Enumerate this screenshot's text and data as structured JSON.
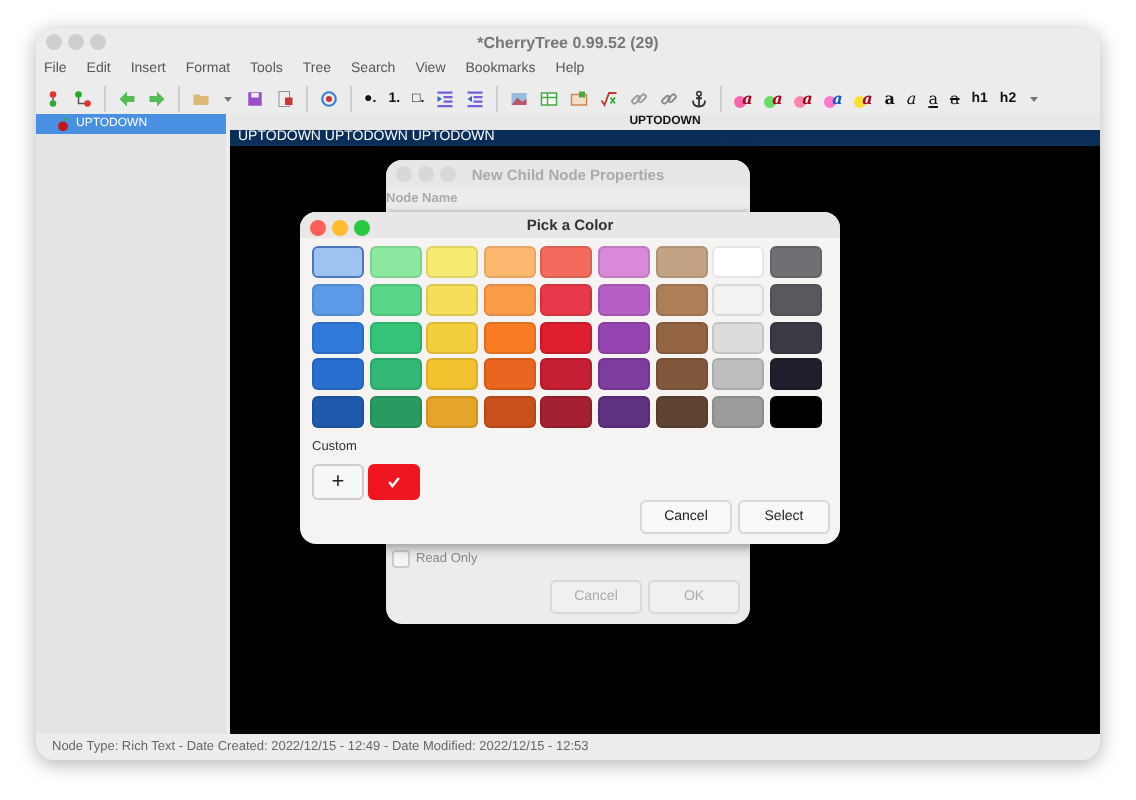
{
  "window": {
    "title": "*CherryTree 0.99.52 (29)"
  },
  "menu": [
    "File",
    "Edit",
    "Insert",
    "Format",
    "Tools",
    "Tree",
    "Search",
    "View",
    "Bookmarks",
    "Help"
  ],
  "toolbar": {
    "labels": [
      "●.",
      "1.",
      "□.",
      "a",
      "a",
      "a",
      "a",
      "a",
      "a",
      "a",
      "a",
      "a",
      "h1",
      "h2"
    ]
  },
  "tree": {
    "items": [
      {
        "label": "UPTODOWN",
        "selected": true
      }
    ]
  },
  "editor": {
    "node_title": "UPTODOWN",
    "text": "UPTODOWN UPTODOWN UPTODOWN"
  },
  "node_dialog": {
    "title": "New Child Node Properties",
    "field_label": "Node Name",
    "read_only": {
      "label": "Read Only",
      "checked": false
    },
    "buttons": [
      "Cancel",
      "OK"
    ]
  },
  "color_dialog": {
    "title": "Pick a Color",
    "colors": [
      {
        "color": "#9ec3f0",
        "selected": true
      },
      {
        "color": "#8de8a0",
        "selected": false
      },
      {
        "color": "#f7ea72",
        "selected": false
      },
      {
        "color": "#fdb870",
        "selected": false
      },
      {
        "color": "#f26b5c",
        "selected": false
      },
      {
        "color": "#d88ad8",
        "selected": false
      },
      {
        "color": "#c4a384",
        "selected": false
      },
      {
        "color": "#ffffff",
        "selected": false
      },
      {
        "color": "#707074",
        "selected": false
      },
      {
        "color": "#5b9ae6",
        "selected": false
      },
      {
        "color": "#5ad688",
        "selected": false
      },
      {
        "color": "#f6dd5a",
        "selected": false
      },
      {
        "color": "#fb9c48",
        "selected": false
      },
      {
        "color": "#e8394a",
        "selected": false
      },
      {
        "color": "#b65fc4",
        "selected": false
      },
      {
        "color": "#ad7f59",
        "selected": false
      },
      {
        "color": "#f2f2f2",
        "selected": false
      },
      {
        "color": "#58585e",
        "selected": false
      },
      {
        "color": "#2f7ad9",
        "selected": false
      },
      {
        "color": "#34c477",
        "selected": false
      },
      {
        "color": "#f4cf3d",
        "selected": false
      },
      {
        "color": "#f97c25",
        "selected": false
      },
      {
        "color": "#dc1e2f",
        "selected": false
      },
      {
        "color": "#9545b0",
        "selected": false
      },
      {
        "color": "#936443",
        "selected": false
      },
      {
        "color": "#dcdcdc",
        "selected": false
      },
      {
        "color": "#3a3a44",
        "selected": false
      },
      {
        "color": "#2a6fcf",
        "selected": false
      },
      {
        "color": "#33b775",
        "selected": false
      },
      {
        "color": "#f2c22e",
        "selected": false
      },
      {
        "color": "#e8661f",
        "selected": false
      },
      {
        "color": "#c51f34",
        "selected": false
      },
      {
        "color": "#7e3c9e",
        "selected": false
      },
      {
        "color": "#82583d",
        "selected": false
      },
      {
        "color": "#bebebe",
        "selected": false
      },
      {
        "color": "#201e2c",
        "selected": false
      },
      {
        "color": "#1f5aad",
        "selected": false
      },
      {
        "color": "#2a9b60",
        "selected": false
      },
      {
        "color": "#e5a42a",
        "selected": false
      },
      {
        "color": "#c8501a",
        "selected": false
      },
      {
        "color": "#a31f32",
        "selected": false
      },
      {
        "color": "#5f3181",
        "selected": false
      },
      {
        "color": "#5e4330",
        "selected": false
      },
      {
        "color": "#9b9b9b",
        "selected": false
      },
      {
        "color": "#000000",
        "selected": false
      }
    ],
    "custom_label": "Custom",
    "add_label": "+",
    "custom_colors": [
      {
        "color": "#f01620",
        "selected": true
      }
    ],
    "buttons": [
      "Cancel",
      "Select"
    ]
  },
  "status_bar": "Node Type: Rich Text  -  Date Created: 2022/12/15 - 12:49  -  Date Modified: 2022/12/15 - 12:53"
}
